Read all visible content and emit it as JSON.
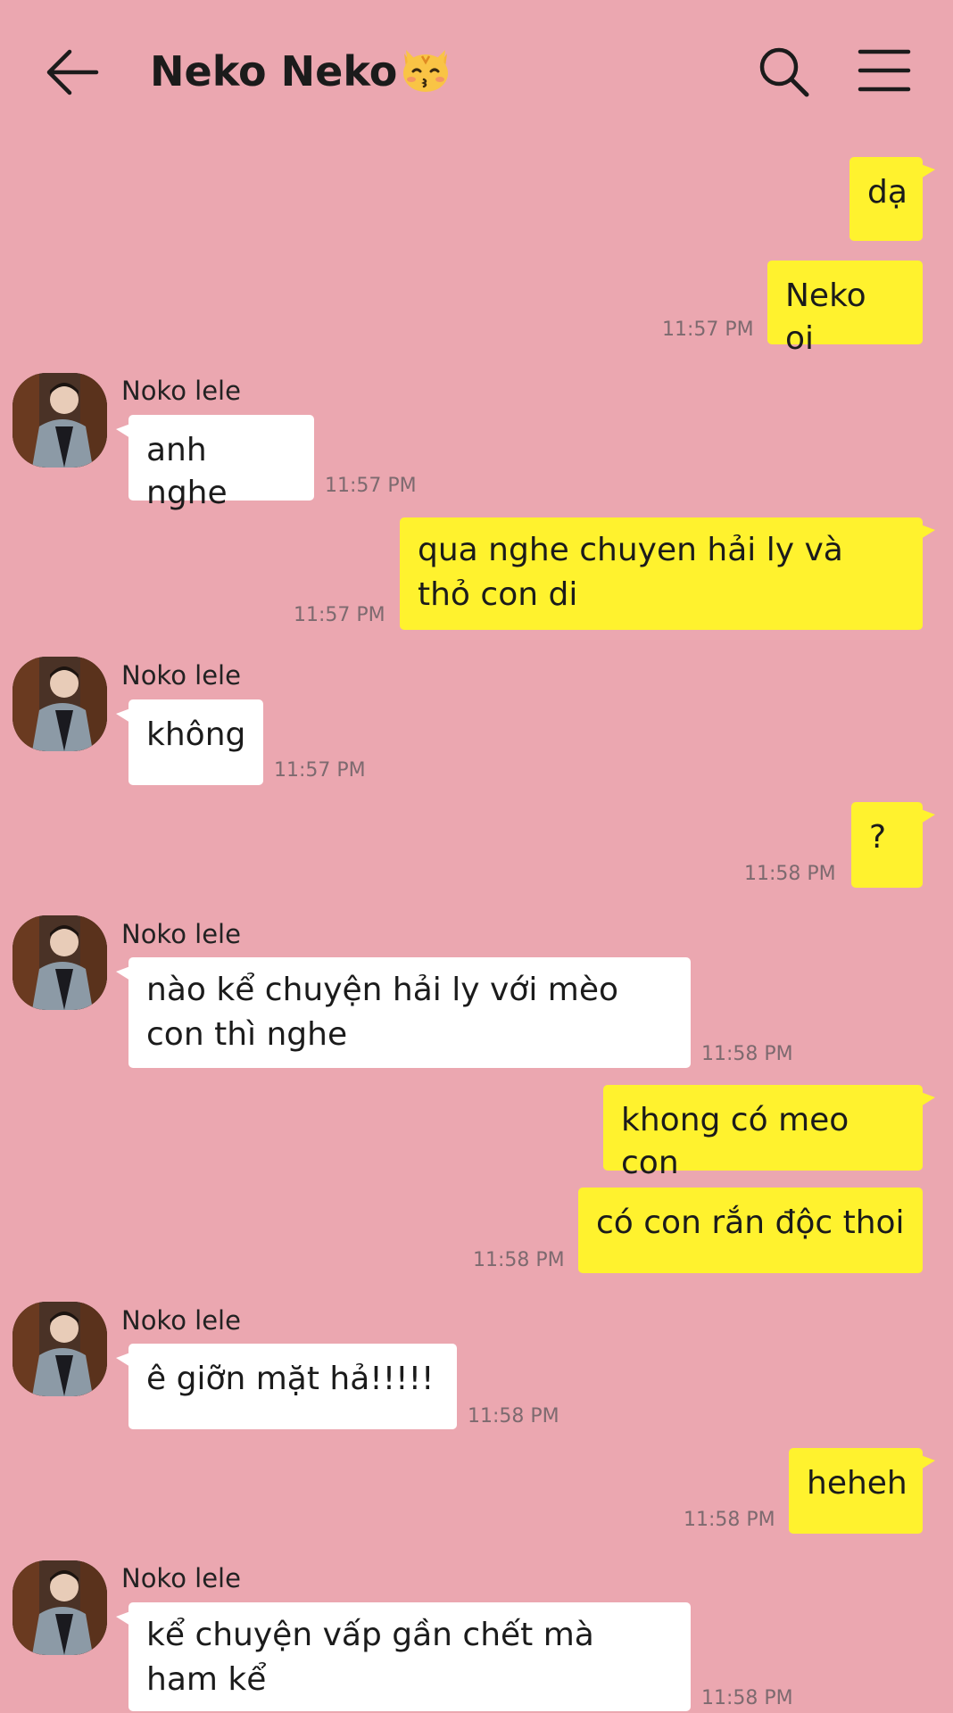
{
  "header": {
    "title": "Neko Neko",
    "title_emoji": "cat-kiss-emoji",
    "back_icon": "arrow-left-icon",
    "search_icon": "search-icon",
    "menu_icon": "hamburger-menu-icon"
  },
  "colors": {
    "background": "#eba7b0",
    "outgoing_bubble": "#fff22e",
    "incoming_bubble": "#ffffff",
    "timestamp": "#7d6a6f"
  },
  "messages": [
    {
      "direction": "out",
      "text": "dạ",
      "time": ""
    },
    {
      "direction": "out",
      "text": "Neko oi",
      "time": "11:57 PM"
    },
    {
      "direction": "in",
      "sender": "Noko lele",
      "text": "anh nghe",
      "time": "11:57 PM"
    },
    {
      "direction": "out",
      "text": "qua nghe chuyen hải ly và thỏ con di",
      "time": "11:57 PM"
    },
    {
      "direction": "in",
      "sender": "Noko lele",
      "text": "không",
      "time": "11:57 PM"
    },
    {
      "direction": "out",
      "text": "?",
      "time": "11:58 PM"
    },
    {
      "direction": "in",
      "sender": "Noko lele",
      "text": "nào kể chuyện hải ly với mèo con thì nghe",
      "time": "11:58 PM"
    },
    {
      "direction": "out",
      "text": "khong có meo con",
      "time": ""
    },
    {
      "direction": "out",
      "text": "có con rắn độc thoi",
      "time": "11:58 PM"
    },
    {
      "direction": "in",
      "sender": "Noko lele",
      "text": "ê giỡn mặt hả!!!!!",
      "time": "11:58 PM"
    },
    {
      "direction": "out",
      "text": "heheh",
      "time": "11:58 PM"
    },
    {
      "direction": "in",
      "sender": "Noko lele",
      "text": "kể chuyện vấp gần chết mà ham kể",
      "time": "11:58 PM"
    }
  ]
}
